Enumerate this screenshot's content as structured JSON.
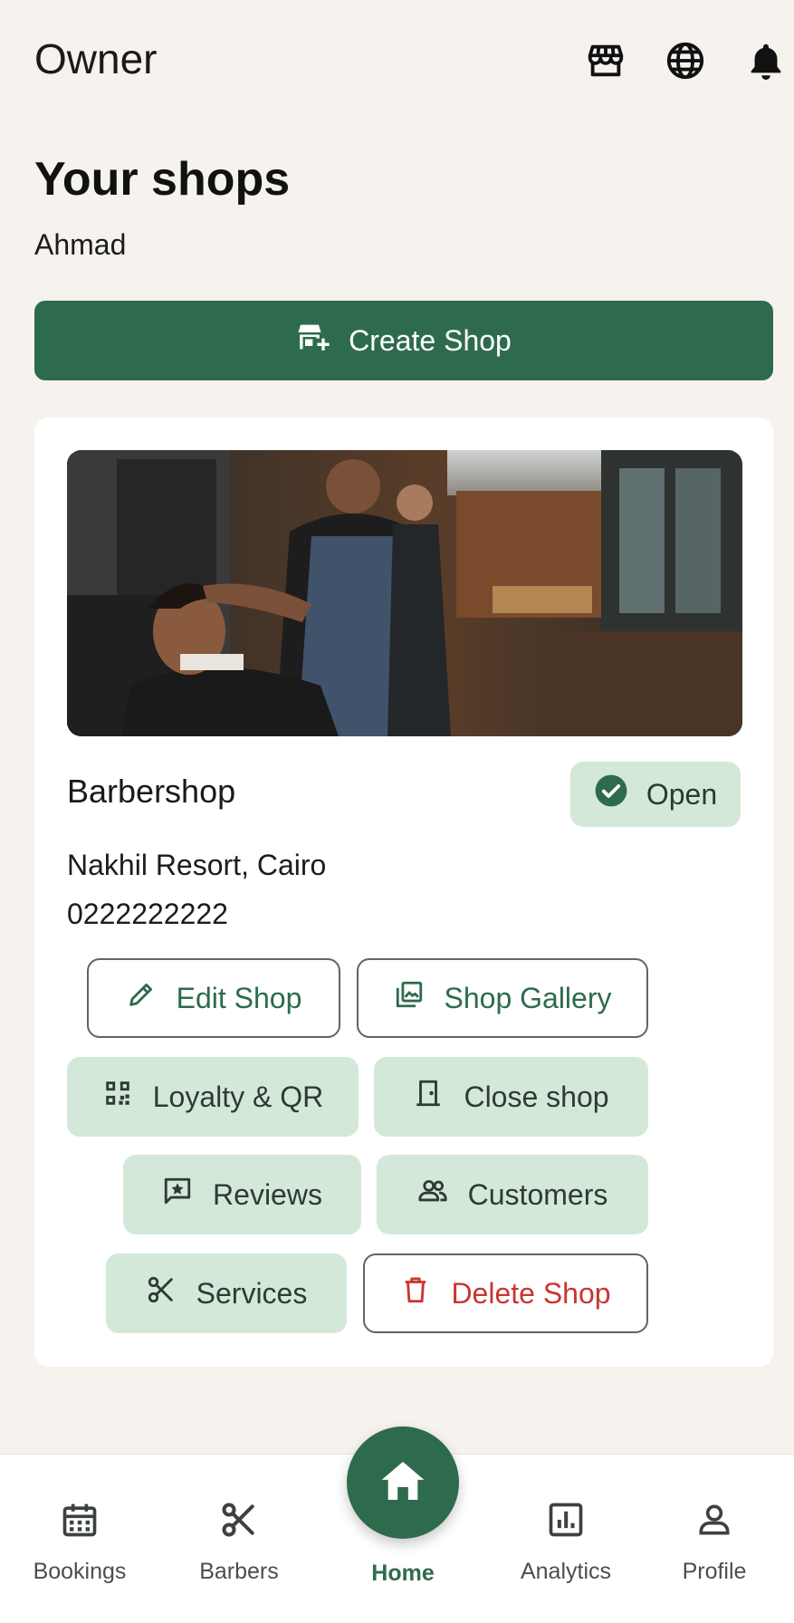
{
  "appbar": {
    "title": "Owner",
    "icons": [
      "storefront-icon",
      "globe-icon",
      "bell-icon"
    ]
  },
  "page": {
    "heading": "Your shops",
    "owner_name": "Ahmad"
  },
  "create_button": {
    "label": "Create Shop",
    "icon": "add-business-icon"
  },
  "shop": {
    "name": "Barbershop",
    "status": "Open",
    "address": "Nakhil Resort, Cairo",
    "phone": "0222222222",
    "actions": {
      "edit": "Edit Shop",
      "gallery": "Shop Gallery",
      "loyalty": "Loyalty & QR",
      "close": "Close shop",
      "reviews": "Reviews",
      "customers": "Customers",
      "services": "Services",
      "delete": "Delete Shop"
    }
  },
  "bottom_nav": {
    "bookings": "Bookings",
    "barbers": "Barbers",
    "home": "Home",
    "analytics": "Analytics",
    "profile": "Profile",
    "active": "Home"
  },
  "colors": {
    "primary": "#2e6b4c",
    "tonal": "#d4e8da",
    "danger": "#c9362f",
    "background": "#f6f3ef"
  }
}
